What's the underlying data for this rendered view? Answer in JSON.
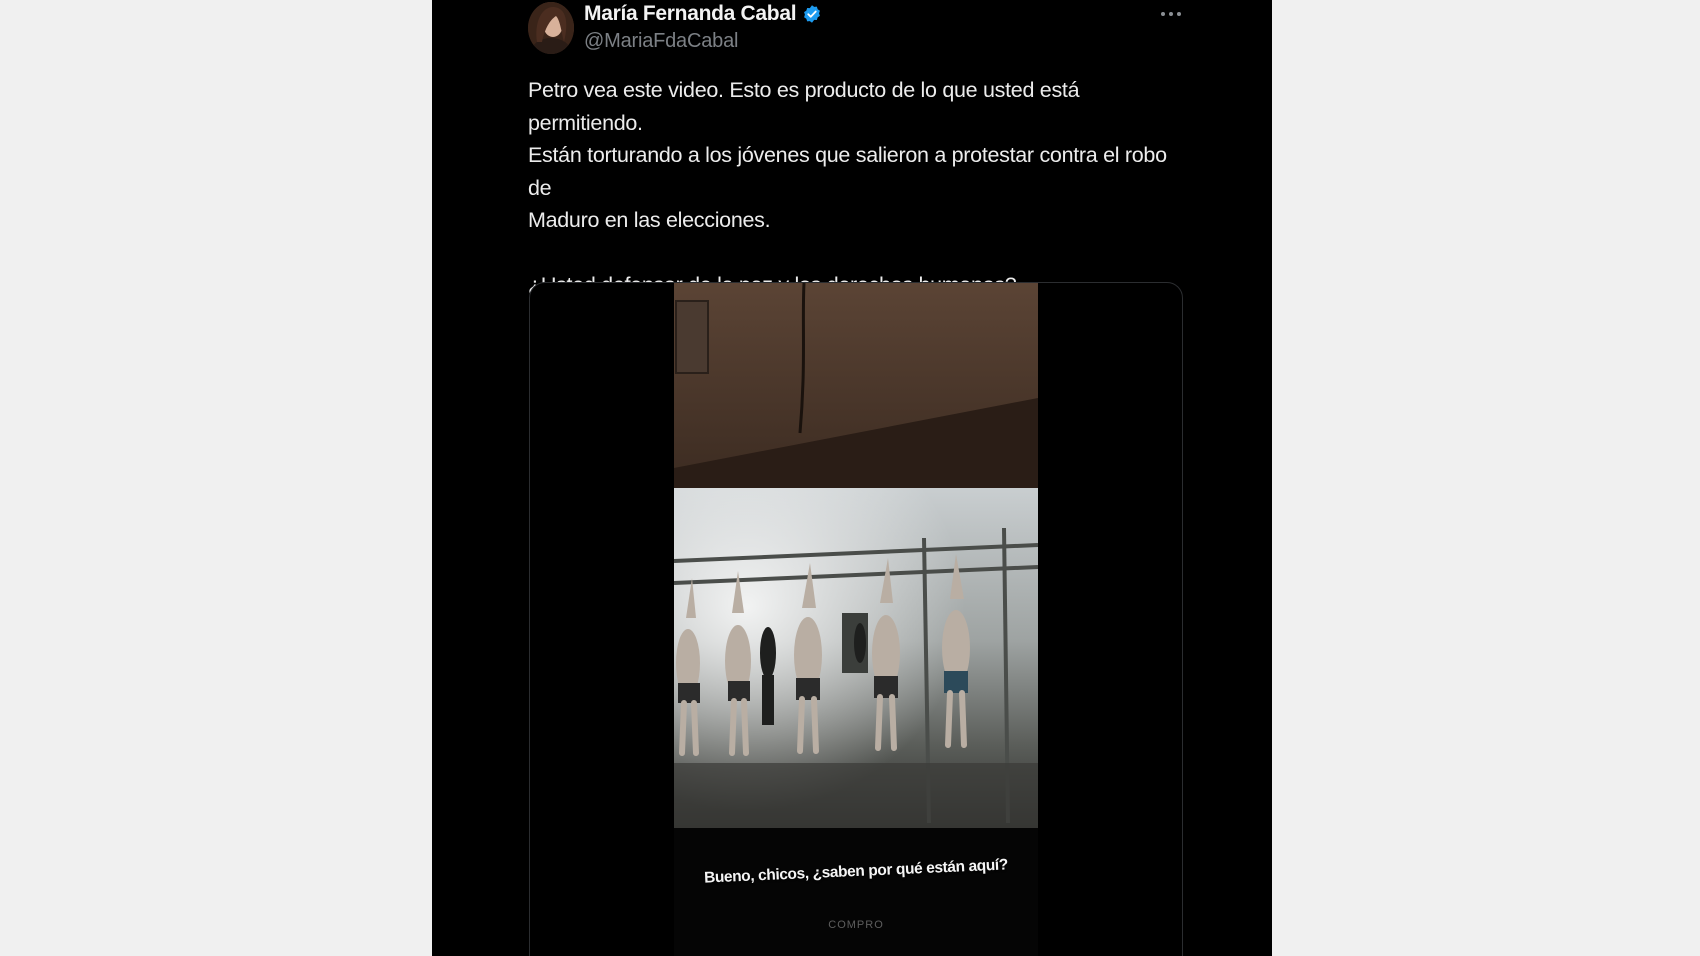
{
  "tweet": {
    "author": {
      "name": "María Fernanda Cabal",
      "handle": "@MariaFdaCabal",
      "verified": true,
      "verified_color": "#1d9bf0"
    },
    "more_icon": "more-horizontal-icon",
    "text": {
      "paragraph1": "Petro vea este video. Esto es producto de lo que usted está permitiendo.\nEstán torturando a los jóvenes que salieron a protestar contra el robo de\nMaduro en las elecciones.",
      "paragraph2": "¿Usted defensor de la paz y los derechos humanos?"
    },
    "media": {
      "type": "video",
      "caption": "Bueno, chicos, ¿saben por qué están aquí?",
      "watermark": "COMPRO"
    }
  },
  "colors": {
    "card_background": "#000000",
    "page_background": "#f0f0f0",
    "text": "#ececec",
    "handle": "#7c8085"
  }
}
